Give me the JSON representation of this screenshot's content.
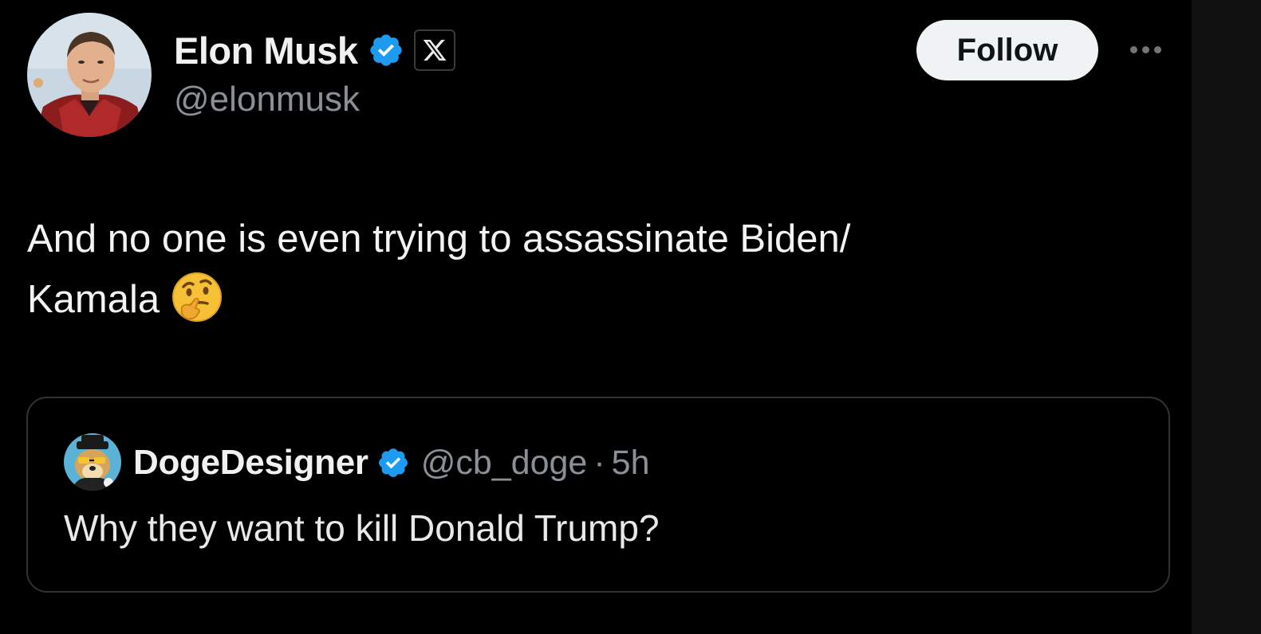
{
  "author": {
    "display_name": "Elon Musk",
    "handle": "@elonmusk",
    "avatar": "profile-photo",
    "verified_icon": "verified-badge-icon",
    "affiliate_icon": "x-logo-icon"
  },
  "actions": {
    "follow_label": "Follow",
    "more_icon": "more-options-icon"
  },
  "tweet": {
    "text_line_1": "And no one is even trying to assassinate Biden/",
    "text_line_2": "Kamala",
    "emoji": "thinking-face"
  },
  "quoted_tweet": {
    "display_name": "DogeDesigner",
    "handle": "@cb_doge",
    "separator": "·",
    "time": "5h",
    "text": "Why they want to kill Donald Trump?",
    "avatar": "doge-avatar",
    "verified_icon": "verified-badge-icon"
  },
  "colors": {
    "background": "#000000",
    "text_primary": "#e7e9ea",
    "text_secondary": "#8b9096",
    "verified_blue": "#1d9bf0",
    "follow_bg": "#eff3f4",
    "card_border": "#2f3336"
  }
}
